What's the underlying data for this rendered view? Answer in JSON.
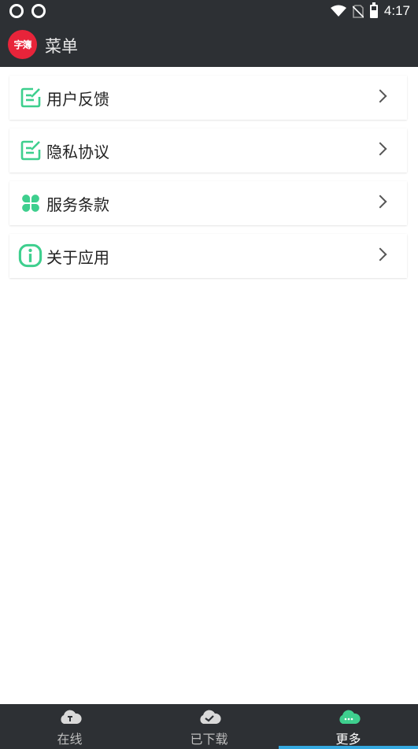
{
  "status_bar": {
    "time": "4:17"
  },
  "app_bar": {
    "logo_text": "字簿",
    "title": "菜单"
  },
  "menu": {
    "items": [
      {
        "label": "用户反馈",
        "icon": "edit-note-icon"
      },
      {
        "label": "隐私协议",
        "icon": "edit-note-icon"
      },
      {
        "label": "服务条款",
        "icon": "clover-grid-icon"
      },
      {
        "label": "关于应用",
        "icon": "info-icon"
      }
    ]
  },
  "bottom_nav": {
    "tabs": [
      {
        "label": "在线",
        "icon": "cloud-text-icon",
        "active": false
      },
      {
        "label": "已下载",
        "icon": "cloud-check-icon",
        "active": false
      },
      {
        "label": "更多",
        "icon": "cloud-more-icon",
        "active": true
      }
    ]
  },
  "colors": {
    "bar_bg": "#2d3034",
    "accent_green": "#3ecf8e",
    "active_tab_indicator": "#35a9e0",
    "logo_red": "#e8243a"
  }
}
